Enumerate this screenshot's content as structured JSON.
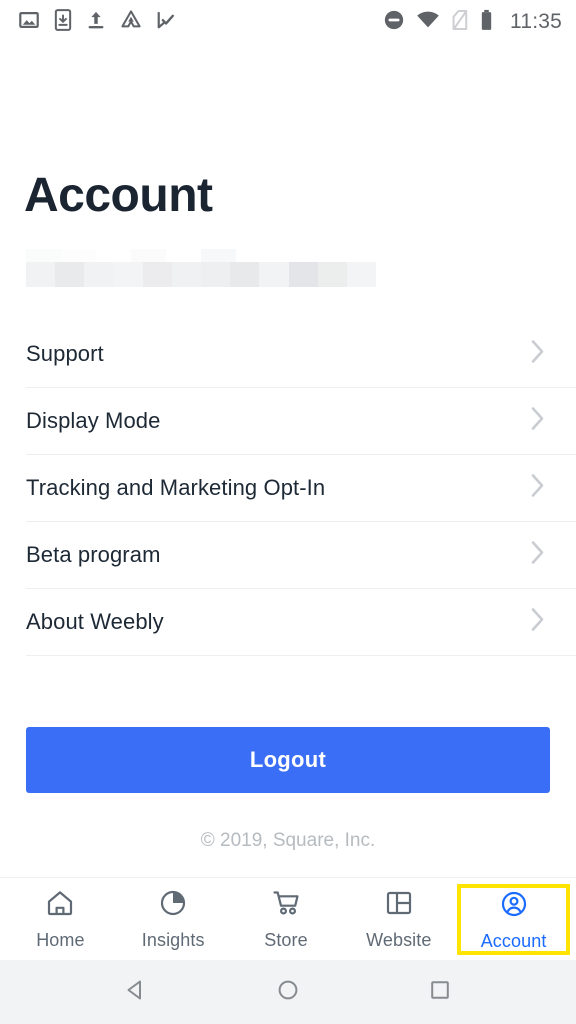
{
  "status_bar": {
    "left_icons": [
      {
        "name": "image-icon"
      },
      {
        "name": "app-download-icon"
      },
      {
        "name": "upload-icon"
      },
      {
        "name": "google-drive-icon"
      },
      {
        "name": "tasks-check-icon"
      }
    ],
    "right_icons": [
      {
        "name": "do-not-disturb-icon"
      },
      {
        "name": "wifi-icon"
      },
      {
        "name": "no-sim-icon"
      },
      {
        "name": "battery-icon"
      }
    ],
    "time": "11:35"
  },
  "header": {
    "title": "Account",
    "account_email_redacted": ""
  },
  "settings_list": [
    {
      "label": "Support",
      "chevron": "chevron-right-icon"
    },
    {
      "label": "Display Mode",
      "chevron": "chevron-right-icon"
    },
    {
      "label": "Tracking and Marketing Opt-In",
      "chevron": "chevron-right-icon"
    },
    {
      "label": "Beta program",
      "chevron": "chevron-right-icon"
    },
    {
      "label": "About Weebly",
      "chevron": "chevron-right-icon"
    }
  ],
  "actions": {
    "logout_label": "Logout"
  },
  "footer": {
    "copyright": "© 2019, Square, Inc."
  },
  "tab_bar": {
    "items": [
      {
        "label": "Home",
        "icon": "home-icon",
        "active": false
      },
      {
        "label": "Insights",
        "icon": "pie-chart-icon",
        "active": false
      },
      {
        "label": "Store",
        "icon": "shopping-cart-icon",
        "active": false
      },
      {
        "label": "Website",
        "icon": "layout-grid-icon",
        "active": false
      },
      {
        "label": "Account",
        "icon": "account-circle-icon",
        "active": true
      }
    ],
    "active_label": "Account",
    "highlight_color": "#ffe400"
  },
  "android_nav": {
    "buttons": [
      {
        "name": "back-button",
        "icon": "triangle-left-icon"
      },
      {
        "name": "home-button",
        "icon": "circle-icon"
      },
      {
        "name": "recents-button",
        "icon": "square-icon"
      }
    ]
  },
  "colors": {
    "accent_blue": "#3b6ef6",
    "active_tab_blue": "#1a6bff",
    "title_dark": "#1b2532",
    "divider": "#eceef0",
    "muted_text": "#b6bbc0",
    "icon_gray": "#5f6a75"
  }
}
